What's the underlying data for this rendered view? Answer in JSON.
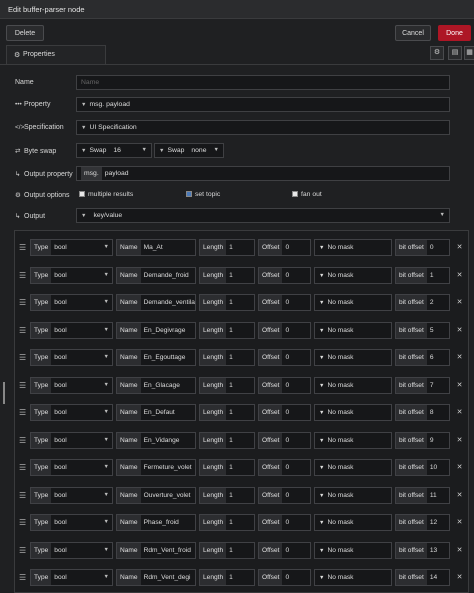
{
  "window": {
    "title": "Edit buffer-parser node"
  },
  "toolbar": {
    "delete_label": "Delete",
    "cancel_label": "Cancel",
    "done_label": "Done"
  },
  "tabs": {
    "properties_label": "Properties"
  },
  "form": {
    "name_label": "Name",
    "name_placeholder": "Name",
    "property_label": "Property",
    "property_prefix": "msg.",
    "property_value": "payload",
    "specification_label": "Specification",
    "specification_value": "UI Specification",
    "byteswap_label": "Byte swap",
    "swap1_prefix": "Swap",
    "swap1_value": "16",
    "swap2_prefix": "Swap",
    "swap2_value": "none",
    "output_property_label": "Output property",
    "output_property_prefix": "msg.",
    "output_property_value": "payload",
    "output_options_label": "Output options",
    "opt_multiple": "multiple results",
    "opt_settopic": "set topic",
    "opt_fanout": "fan out",
    "output_label": "Output",
    "output_value": "key/value"
  },
  "row_labels": {
    "type": "Type",
    "name": "Name",
    "length": "Length",
    "offset": "Offset",
    "mask": "No mask",
    "bitoffset": "bit offset"
  },
  "items": [
    {
      "type": "bool",
      "name": "Ma_At",
      "length": "1",
      "offset": "0",
      "bit": "0"
    },
    {
      "type": "bool",
      "name": "Demande_froid",
      "length": "1",
      "offset": "0",
      "bit": "1"
    },
    {
      "type": "bool",
      "name": "Demande_ventila",
      "length": "1",
      "offset": "0",
      "bit": "2"
    },
    {
      "type": "bool",
      "name": "En_Degivrage",
      "length": "1",
      "offset": "0",
      "bit": "5"
    },
    {
      "type": "bool",
      "name": "En_Egouttage",
      "length": "1",
      "offset": "0",
      "bit": "6"
    },
    {
      "type": "bool",
      "name": "En_Glacage",
      "length": "1",
      "offset": "0",
      "bit": "7"
    },
    {
      "type": "bool",
      "name": "En_Defaut",
      "length": "1",
      "offset": "0",
      "bit": "8"
    },
    {
      "type": "bool",
      "name": "En_Vidange",
      "length": "1",
      "offset": "0",
      "bit": "9"
    },
    {
      "type": "bool",
      "name": "Fermeture_volet",
      "length": "1",
      "offset": "0",
      "bit": "10"
    },
    {
      "type": "bool",
      "name": "Ouverture_volet",
      "length": "1",
      "offset": "0",
      "bit": "11"
    },
    {
      "type": "bool",
      "name": "Phase_froid",
      "length": "1",
      "offset": "0",
      "bit": "12"
    },
    {
      "type": "bool",
      "name": "Rdm_Vent_froid",
      "length": "1",
      "offset": "0",
      "bit": "13"
    },
    {
      "type": "bool",
      "name": "Rdm_Vent_degi",
      "length": "1",
      "offset": "0",
      "bit": "14"
    }
  ]
}
